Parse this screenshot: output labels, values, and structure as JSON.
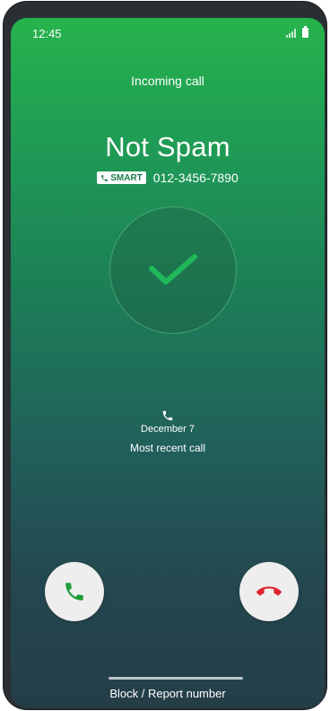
{
  "status_bar": {
    "time": "12:45",
    "icons": [
      "signal-icon",
      "battery-icon"
    ]
  },
  "call": {
    "incoming_label": "Incoming call",
    "caller_name": "Not Spam",
    "badge_label": "SMART",
    "phone_number": "012-3456-7890",
    "verified_icon": "check-icon"
  },
  "recent": {
    "icon": "phone-icon",
    "date": "December 7",
    "label": "Most recent call"
  },
  "actions": {
    "answer_icon": "phone-answer-icon",
    "decline_icon": "phone-decline-icon",
    "block_report_label": "Block / Report number"
  },
  "colors": {
    "answer": "#1e9e3c",
    "decline": "#e0242f",
    "check": "#1fb85a",
    "gradient_top": "#26b34c",
    "gradient_bottom": "#243e48"
  }
}
